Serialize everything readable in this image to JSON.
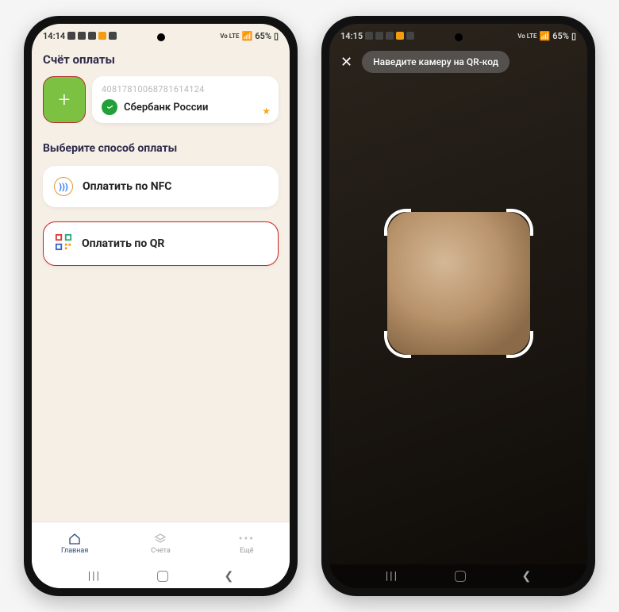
{
  "phone1": {
    "status": {
      "time": "14:14",
      "battery": "65%",
      "net": "Vo LTE"
    },
    "title": "Счёт оплаты",
    "add_card_plus": "+",
    "card": {
      "number": "40817810068781614124",
      "bank": "Сбербанк России"
    },
    "section": "Выберите способ оплаты",
    "options": {
      "nfc": "Оплатить по NFC",
      "qr": "Оплатить по QR"
    },
    "tabs": {
      "home": "Главная",
      "accounts": "Счета",
      "more": "Ещё"
    }
  },
  "phone2": {
    "status": {
      "time": "14:15",
      "battery": "65%",
      "net": "Vo LTE"
    },
    "hint": "Наведите камеру на QR-код"
  },
  "nav": {
    "recents": "|||",
    "home": "○",
    "back": "‹"
  }
}
